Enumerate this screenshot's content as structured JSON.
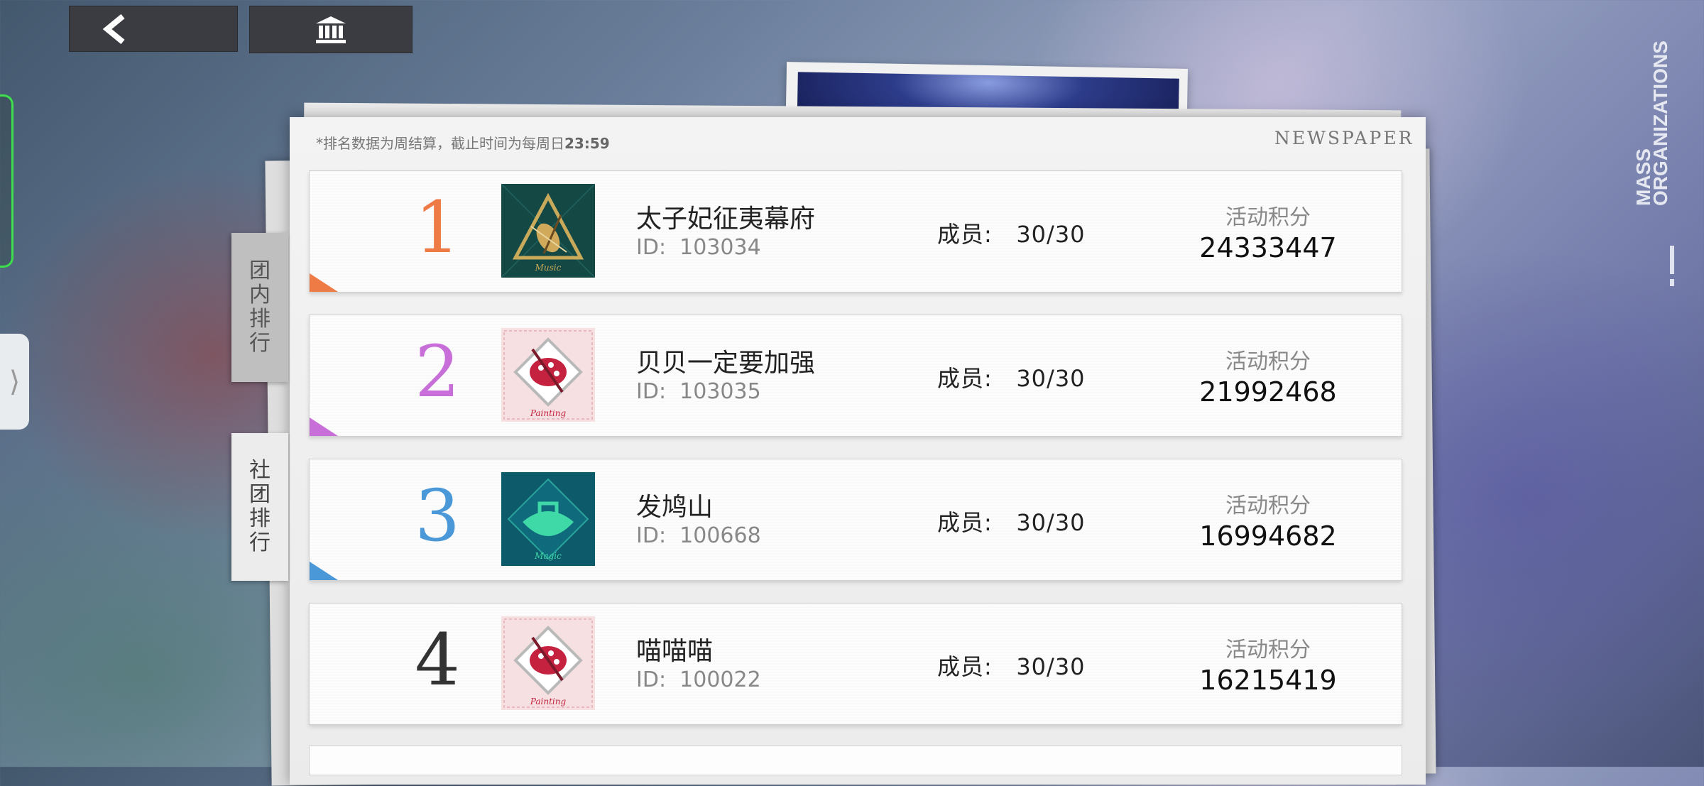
{
  "nav": {
    "back_icon": "chevron-left-icon",
    "home_icon": "building-icon"
  },
  "side_title": [
    "MASS",
    "ORGANIZATIONS"
  ],
  "notice": {
    "text": "*排名数据为周结算，截止时间为每周日",
    "time": "23:59"
  },
  "newspaper_label": "NEWSPAPER",
  "tabs": [
    {
      "label": "团内排行",
      "active": false
    },
    {
      "label": "社团排行",
      "active": true
    }
  ],
  "colors": {
    "rank1": "#ee7a45",
    "rank2": "#c86ed8",
    "rank3": "#4a98d8",
    "rank4": "#333333",
    "music_bg": "#134845",
    "painting_bg": "#f7e0e2",
    "magic_bg": "#0d5a6a"
  },
  "rankings": [
    {
      "rank": "1",
      "emblem": "music-violin-emblem",
      "name": "太子妃征夷幕府",
      "id_label": "ID:",
      "id": "103034",
      "members_label": "成员:",
      "members": "30/30",
      "score_label": "活动积分",
      "score": "24333447"
    },
    {
      "rank": "2",
      "emblem": "painting-palette-emblem",
      "name": "贝贝一定要加强",
      "id_label": "ID:",
      "id": "103035",
      "members_label": "成员:",
      "members": "30/30",
      "score_label": "活动积分",
      "score": "21992468"
    },
    {
      "rank": "3",
      "emblem": "magic-emblem",
      "name": "发鸠山",
      "id_label": "ID:",
      "id": "100668",
      "members_label": "成员:",
      "members": "30/30",
      "score_label": "活动积分",
      "score": "16994682"
    },
    {
      "rank": "4",
      "emblem": "painting-palette-emblem",
      "name": "喵喵喵",
      "id_label": "ID:",
      "id": "100022",
      "members_label": "成员:",
      "members": "30/30",
      "score_label": "活动积分",
      "score": "16215419"
    }
  ]
}
